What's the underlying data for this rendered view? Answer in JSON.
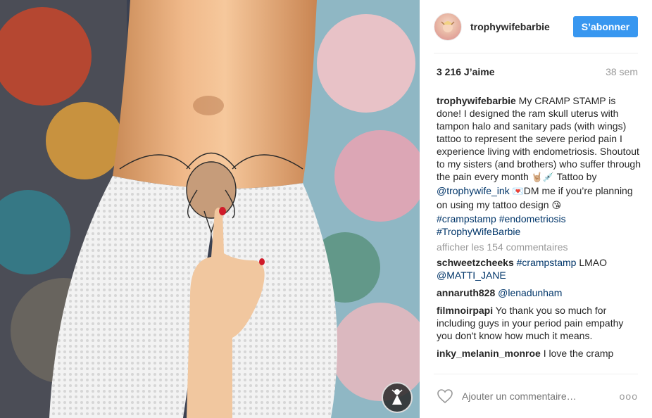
{
  "post": {
    "username": "trophywifebarbie",
    "follow_label": "S’abonner",
    "likes": "3 216 J’aime",
    "time_ago": "38 sem",
    "caption": {
      "username": "trophywifebarbie",
      "text": " My CRAMP STAMP is done! I designed the ram skull uterus with tampon halo and sanitary pads (with wings) tattoo to represent the severe period pain I experience living with endometriosis. Shoutout to my sisters (and brothers) who suffer through the pain every month ",
      "emoji1": "🤘🏼💉",
      "text2": " Tattoo by ",
      "mention": "@trophywife_ink",
      "emoji2": "💌",
      "text3": "DM me if you’re planning on using my tattoo design ",
      "emoji3": "😘",
      "hashtag1": "#crampstamp",
      "hashtag2": "#endometriosis",
      "hashtag3": "#TrophyWifeBarbie"
    },
    "view_more": "afficher les 154 commentaires",
    "comments": [
      {
        "username": "schweetzcheeks",
        "tag": "#crampstamp",
        "text": " LMAO ",
        "mention": "@MATTI_JANE"
      },
      {
        "username": "annaruth828",
        "mention": "@lenadunham"
      },
      {
        "username": "filmnoirpapi",
        "text": "Yo thank you so much for including guys in your period pain empathy you don't know how much it means."
      },
      {
        "username": "inky_melanin_monroe",
        "text": "I love the cramp"
      }
    ],
    "add_comment_placeholder": "Ajouter un commentaire…",
    "more_options": "ooo",
    "icons": {
      "heart": "heart-outline-icon",
      "more": "more-options-icon",
      "badge": "barbie-logo-icon"
    },
    "colors": {
      "follow_button": "#3897f0",
      "hashtag": "#003569",
      "muted": "#999999"
    }
  }
}
